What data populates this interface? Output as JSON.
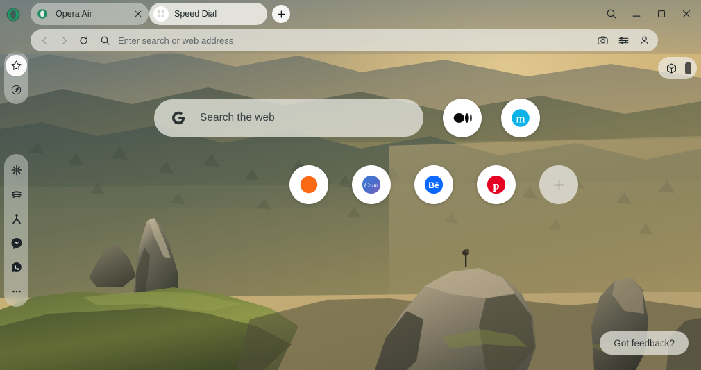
{
  "window": {
    "app_name": "Opera Air",
    "corner_logo_icon": "opera-logo-icon"
  },
  "tabs": {
    "items": [
      {
        "title": "Opera Air",
        "favicon": "opera-logo-icon",
        "active": false,
        "close_icon": "close-icon"
      },
      {
        "title": "Speed Dial",
        "favicon": "speed-dial-grid-icon",
        "active": true,
        "close_icon": "close-icon"
      }
    ],
    "new_tab_label": "+",
    "new_tab_icon": "plus-icon"
  },
  "window_controls": {
    "search": {
      "label": "Search",
      "icon": "search-icon"
    },
    "minimize": {
      "label": "Minimize",
      "icon": "minimize-icon"
    },
    "maximize": {
      "label": "Maximize",
      "icon": "maximize-icon"
    },
    "close": {
      "label": "Close",
      "icon": "close-icon"
    }
  },
  "addressbar": {
    "back": {
      "icon": "chevron-left-icon",
      "enabled": false
    },
    "forward": {
      "icon": "chevron-right-icon",
      "enabled": false
    },
    "reload": {
      "icon": "reload-icon"
    },
    "search_icon": "search-icon",
    "value": "",
    "placeholder": "Enter search or web address",
    "actions": [
      {
        "name": "snapshot",
        "icon": "camera-icon"
      },
      {
        "name": "site-settings",
        "icon": "sliders-icon"
      },
      {
        "name": "profile",
        "icon": "person-icon"
      }
    ],
    "right_cluster": [
      {
        "name": "extensions",
        "icon": "cube-icon"
      },
      {
        "name": "sidebar-toggle",
        "icon": "vertical-bar-icon"
      }
    ]
  },
  "sidebar": {
    "top_items": [
      {
        "name": "speed-dial",
        "icon": "star-icon",
        "active": true
      },
      {
        "name": "aria-leaf",
        "icon": "leaf-icon",
        "active": false
      }
    ],
    "bottom_items": [
      {
        "name": "aria",
        "icon": "asterisk-sparkle-icon",
        "active": false
      },
      {
        "name": "boosts",
        "icon": "waves-icon",
        "active": false
      },
      {
        "name": "break-mode",
        "icon": "meditation-person-icon",
        "active": false
      },
      {
        "name": "messenger",
        "icon": "messenger-icon",
        "active": false
      },
      {
        "name": "whatsapp",
        "icon": "whatsapp-icon",
        "active": false
      },
      {
        "name": "more",
        "icon": "ellipsis-icon",
        "active": false
      }
    ]
  },
  "speed_dial": {
    "search": {
      "engine": "Google",
      "engine_icon": "google-g-icon",
      "placeholder": "Search the web"
    },
    "pinned_top": [
      {
        "name": "medium",
        "icon": "medium-logo-icon",
        "accent": "#000000"
      },
      {
        "name": "mega",
        "icon": "mega-m-logo-icon",
        "accent": "#0cb3e8"
      }
    ],
    "tiles": [
      {
        "name": "orange-site",
        "icon": "orange-circle-icon",
        "accent": "#f96815"
      },
      {
        "name": "calm",
        "icon": "calm-logo-icon",
        "accent": "#3e6dc4",
        "label": "Calm"
      },
      {
        "name": "behance",
        "icon": "behance-logo-icon",
        "accent": "#0b69ff",
        "label": "Bē"
      },
      {
        "name": "pinterest",
        "icon": "pinterest-logo-icon",
        "accent": "#e60023"
      },
      {
        "name": "add-tile",
        "icon": "plus-icon",
        "accent": "#444444"
      }
    ]
  },
  "feedback": {
    "label": "Got feedback?"
  },
  "theme": {
    "opera_green": "#17a06a",
    "chrome_tint": "#8b8c7e",
    "tab_active_bg": "#eeeee8",
    "accent_text": "#2d3234"
  }
}
